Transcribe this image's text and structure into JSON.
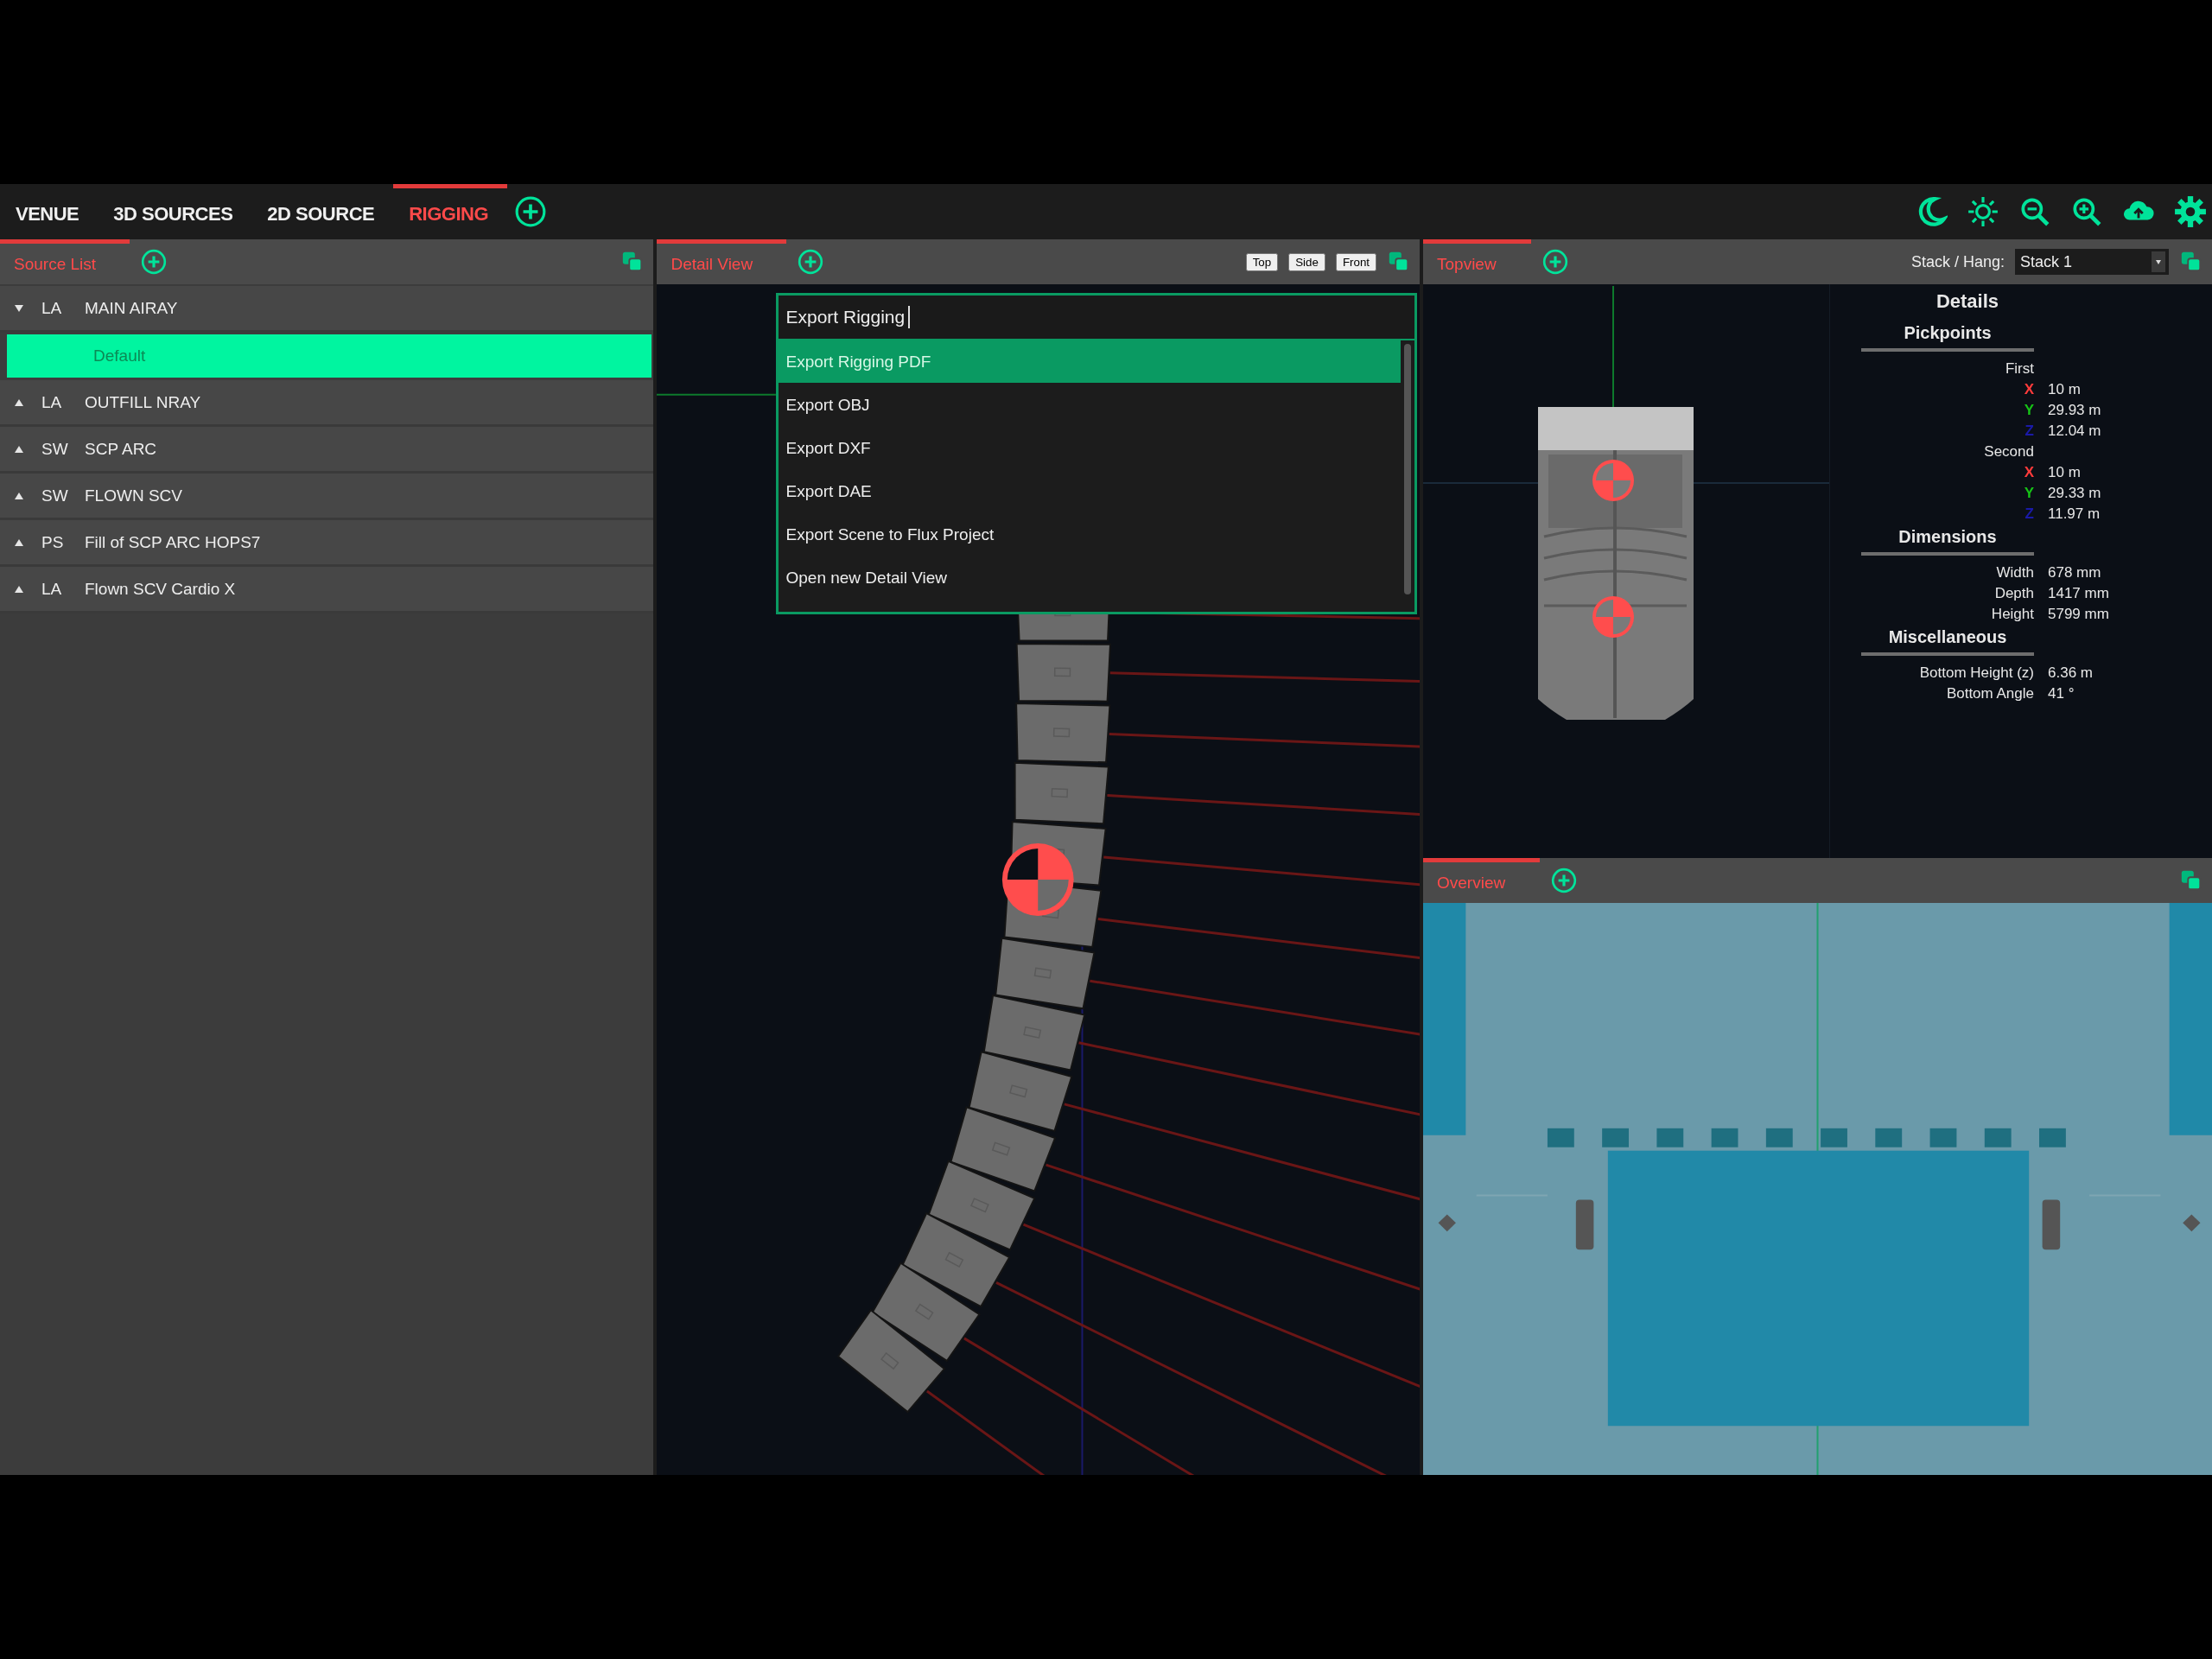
{
  "tabs": [
    {
      "label": "VENUE",
      "selected": false
    },
    {
      "label": "3D SOURCES",
      "selected": false
    },
    {
      "label": "2D SOURCE",
      "selected": false
    },
    {
      "label": "RIGGING",
      "selected": true
    }
  ],
  "source_list": {
    "title": "Source List",
    "items": [
      {
        "type": "LA",
        "name": "MAIN AIRAY",
        "expanded": true,
        "children": [
          {
            "name": "Default",
            "selected": true
          }
        ]
      },
      {
        "type": "LA",
        "name": "OUTFILL NRAY",
        "expanded": false
      },
      {
        "type": "SW",
        "name": "SCP ARC",
        "expanded": false
      },
      {
        "type": "SW",
        "name": "FLOWN SCV",
        "expanded": false
      },
      {
        "type": "PS",
        "name": "Fill of SCP ARC HOPS7",
        "expanded": false
      },
      {
        "type": "LA",
        "name": "Flown SCV Cardio X",
        "expanded": false
      }
    ]
  },
  "detail_view": {
    "title": "Detail View",
    "view_buttons": [
      "Top",
      "Side",
      "Front"
    ],
    "command_palette": {
      "value": "Export Rigging",
      "items": [
        {
          "label": "Export Rigging PDF",
          "selected": true
        },
        {
          "label": "Export OBJ",
          "selected": false
        },
        {
          "label": "Export DXF",
          "selected": false
        },
        {
          "label": "Export DAE",
          "selected": false
        },
        {
          "label": "Export Scene to Flux Project",
          "selected": false
        },
        {
          "label": "Open new Detail View",
          "selected": false
        }
      ]
    }
  },
  "topview": {
    "title": "Topview",
    "stack_label": "Stack / Hang:",
    "stack_value": "Stack 1",
    "details": {
      "title": "Details",
      "sections": [
        {
          "title": "Pickpoints",
          "groups": [
            {
              "label": "First",
              "rows": [
                {
                  "axis": "X",
                  "value": "10 m",
                  "color": "#ff3b3b"
                },
                {
                  "axis": "Y",
                  "value": "29.93 m",
                  "color": "#16c216"
                },
                {
                  "axis": "Z",
                  "value": "12.04 m",
                  "color": "#1a1aa8"
                }
              ]
            },
            {
              "label": "Second",
              "rows": [
                {
                  "axis": "X",
                  "value": "10 m",
                  "color": "#ff3b3b"
                },
                {
                  "axis": "Y",
                  "value": "29.33 m",
                  "color": "#16c216"
                },
                {
                  "axis": "Z",
                  "value": "11.97 m",
                  "color": "#1a1aa8"
                }
              ]
            }
          ]
        },
        {
          "title": "Dimensions",
          "rows": [
            {
              "label": "Width",
              "value": "678 mm"
            },
            {
              "label": "Depth",
              "value": "1417 mm"
            },
            {
              "label": "Height",
              "value": "5799 mm"
            }
          ]
        },
        {
          "title": "Miscellaneous",
          "rows": [
            {
              "label": "Bottom Height (z)",
              "value": "6.36 m"
            },
            {
              "label": "Bottom Angle",
              "value": "41 °"
            }
          ]
        }
      ]
    }
  },
  "overview": {
    "title": "Overview"
  }
}
